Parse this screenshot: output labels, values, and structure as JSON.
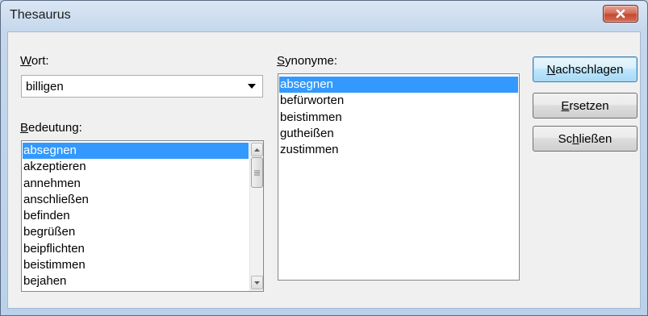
{
  "window": {
    "title": "Thesaurus"
  },
  "wort": {
    "label_mnemonic": "W",
    "label_rest": "ort:",
    "value": "billigen"
  },
  "bedeutung": {
    "label_mnemonic": "B",
    "label_rest": "edeutung:",
    "items": [
      "absegnen",
      "akzeptieren",
      "annehmen",
      "anschließen",
      "befinden",
      "begrüßen",
      "beipflichten",
      "beistimmen",
      "bejahen"
    ],
    "selected": "absegnen"
  },
  "synonyme": {
    "label_mnemonic": "S",
    "label_rest": "ynonyme:",
    "items": [
      "absegnen",
      "befürworten",
      "beistimmen",
      "gutheißen",
      "zustimmen"
    ],
    "selected": "absegnen"
  },
  "buttons": {
    "nachschlagen": {
      "mnemonic": "N",
      "rest": "achschlagen"
    },
    "ersetzen": {
      "mnemonic": "E",
      "rest": "rsetzen"
    },
    "schliessen_pre": "Sc",
    "schliessen_mnemonic": "h",
    "schliessen_post": "ließen"
  },
  "colors": {
    "selection": "#3399ff",
    "close_button": "#c24a32",
    "dialog_background": "#f0f0f0"
  },
  "icons": [
    "close-icon",
    "chevron-down-icon",
    "scroll-up-arrow-icon",
    "scroll-down-arrow-icon",
    "scroll-grip-icon"
  ]
}
